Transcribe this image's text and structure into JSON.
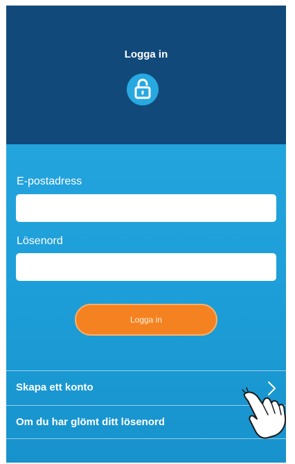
{
  "header": {
    "title": "Logga in",
    "icon": "unlock-icon",
    "background": "#114a7a",
    "icon_circle_color": "#28a8e0"
  },
  "form": {
    "email_label": "E-postadress",
    "email_value": "",
    "password_label": "Lösenord",
    "password_value": "",
    "submit_label": "Logga in",
    "submit_color": "#f58220"
  },
  "links": {
    "items": [
      {
        "label": "Skapa ett konto",
        "icon": "chevron-right-icon"
      },
      {
        "label": "Om du har glömt ditt lösenord"
      }
    ]
  },
  "overlay": {
    "icon": "tap-hand-icon"
  },
  "theme": {
    "body_gradient_top": "#29a9e1",
    "body_gradient_bottom": "#1792cc"
  }
}
